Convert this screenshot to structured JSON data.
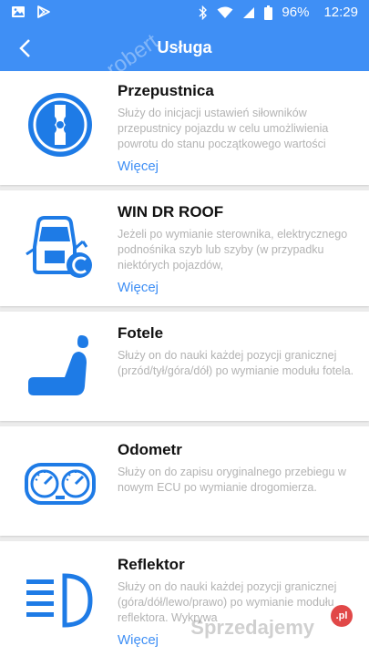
{
  "status_bar": {
    "battery": "96%",
    "time": "12:29"
  },
  "app_bar": {
    "title": "Usługa"
  },
  "items": [
    {
      "title": "Przepustnica",
      "description": "Służy do inicjacji ustawień siłowników przepustnicy pojazdu w celu umożliwienia powrotu do stanu początkowego wartości",
      "more": "Więcej",
      "icon": "throttle-icon"
    },
    {
      "title": "WIN DR ROOF",
      "description": "Jeżeli po wymianie sterownika, elektrycznego podnośnika szyb lub szyby (w przypadku niektórych pojazdów,",
      "more": "Więcej",
      "icon": "car-window-icon"
    },
    {
      "title": "Fotele",
      "description": "Służy on do nauki każdej pozycji granicznej (przód/tył/góra/dół) po wymianie modułu fotela.",
      "icon": "seat-icon"
    },
    {
      "title": "Odometr",
      "description": "Służy on do zapisu oryginalnego przebiegu w nowym ECU po wymianie drogomierza.",
      "icon": "odometer-icon"
    },
    {
      "title": "Reflektor",
      "description": "Służy on do nauki każdej pozycji granicznej (góra/dół/lewo/prawo) po wymianie modułu reflektora. Wykrywa",
      "more": "Więcej",
      "icon": "headlight-icon"
    }
  ],
  "watermark": {
    "text": "Sprzedajemy",
    "badge": ".pl",
    "corner": "robert"
  },
  "colors": {
    "accent": "#3f8ff5",
    "icon_blue": "#1e7be6"
  }
}
